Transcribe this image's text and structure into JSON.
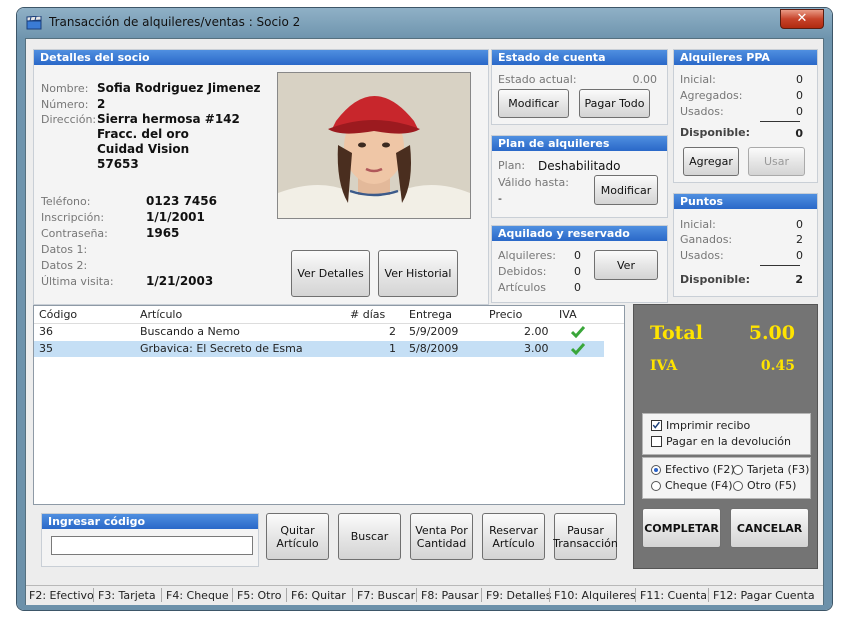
{
  "window": {
    "title": "Transacción de alquileres/ventas : Socio 2",
    "close": "✕"
  },
  "member": {
    "header": "Detalles del socio",
    "name_label": "Nombre:",
    "name": "Sofia Rodriguez Jimenez",
    "number_label": "Número:",
    "number": "2",
    "address_label": "Dirección:",
    "address_lines": [
      "Sierra hermosa #142",
      "Fracc. del oro",
      "Cuidad Vision",
      "57653"
    ],
    "phone_label": "Teléfono:",
    "phone": "0123 7456",
    "signup_label": "Inscripción:",
    "signup": "1/1/2001",
    "password_label": "Contraseña:",
    "password": "1965",
    "data1_label": "Datos 1:",
    "data2_label": "Datos 2:",
    "last_visit_label": "Última visita:",
    "last_visit": "1/21/2003",
    "details_button": "Ver Detalles",
    "history_button": "Ver Historial"
  },
  "account": {
    "header": "Estado de cuenta",
    "state_label": "Estado actual:",
    "state_value": "0.00",
    "modify_button": "Modificar",
    "pay_all_button": "Pagar Todo"
  },
  "plan": {
    "header": "Plan de alquileres",
    "plan_label": "Plan:",
    "plan_value": "Deshabilitado",
    "valid_label": "Válido hasta:",
    "valid_value": "-",
    "modify_button": "Modificar"
  },
  "rented": {
    "header": "Aquilado y reservado",
    "rentals_label": "Alquileres:",
    "rentals": "0",
    "owed_label": "Debidos:",
    "owed": "0",
    "items_label": "Artículos",
    "items": "0",
    "view_button": "Ver"
  },
  "ppa": {
    "header": "Alquileres PPA",
    "initial_label": "Inicial:",
    "initial": "0",
    "added_label": "Agregados:",
    "added": "0",
    "used_label": "Usados:",
    "used": "0",
    "available_label": "Disponible:",
    "available": "0",
    "add_button": "Agregar",
    "use_button": "Usar"
  },
  "points": {
    "header": "Puntos",
    "initial_label": "Inicial:",
    "initial": "0",
    "earned_label": "Ganados:",
    "earned": "2",
    "used_label": "Usados:",
    "used": "0",
    "available_label": "Disponible:",
    "available": "2"
  },
  "items_table": {
    "columns": [
      "Código",
      "Artículo",
      "# días",
      "Entrega",
      "Precio",
      "IVA"
    ],
    "rows": [
      {
        "code": "36",
        "title": "Buscando a Nemo",
        "days": "2",
        "due": "5/9/2009",
        "price": "2.00",
        "tax": "check-icon",
        "selected": false
      },
      {
        "code": "35",
        "title": "Grbavica: El Secreto de Esma",
        "days": "1",
        "due": "5/8/2009",
        "price": "3.00",
        "tax": "check-icon",
        "selected": true
      }
    ]
  },
  "code_entry": {
    "header": "Ingresar código",
    "value": ""
  },
  "actions": {
    "remove": "Quitar Artículo",
    "search": "Buscar",
    "qty_sale": "Venta Por Cantidad",
    "reserve": "Reservar Artículo",
    "pause": "Pausar Transacción"
  },
  "totals": {
    "total_label": "Total",
    "total": "5.00",
    "tax_label": "IVA",
    "tax": "0.45"
  },
  "options": {
    "print_receipt": "Imprimir recibo",
    "print_checked": true,
    "pay_on_return": "Pagar en la devolución",
    "pay_checked": false
  },
  "payment": {
    "methods": [
      "Efectivo (F2)",
      "Tarjeta (F3)",
      "Cheque (F4)",
      "Otro (F5)"
    ],
    "selected": "Efectivo (F2)"
  },
  "complete_button": "COMPLETAR",
  "cancel_button": "CANCELAR",
  "fkeys": [
    "F2: Efectivo",
    "F3: Tarjeta",
    "F4: Cheque",
    "F5: Otro",
    "F6: Quitar",
    "F7: Buscar",
    "F8: Pausar",
    "F9: Detalles",
    "F10: Alquileres",
    "F11: Cuenta",
    "F12: Pagar Cuenta"
  ],
  "colors": {
    "header_blue": "#2a68c8",
    "total_yellow": "#ffe400",
    "selection": "#c5dff5"
  }
}
